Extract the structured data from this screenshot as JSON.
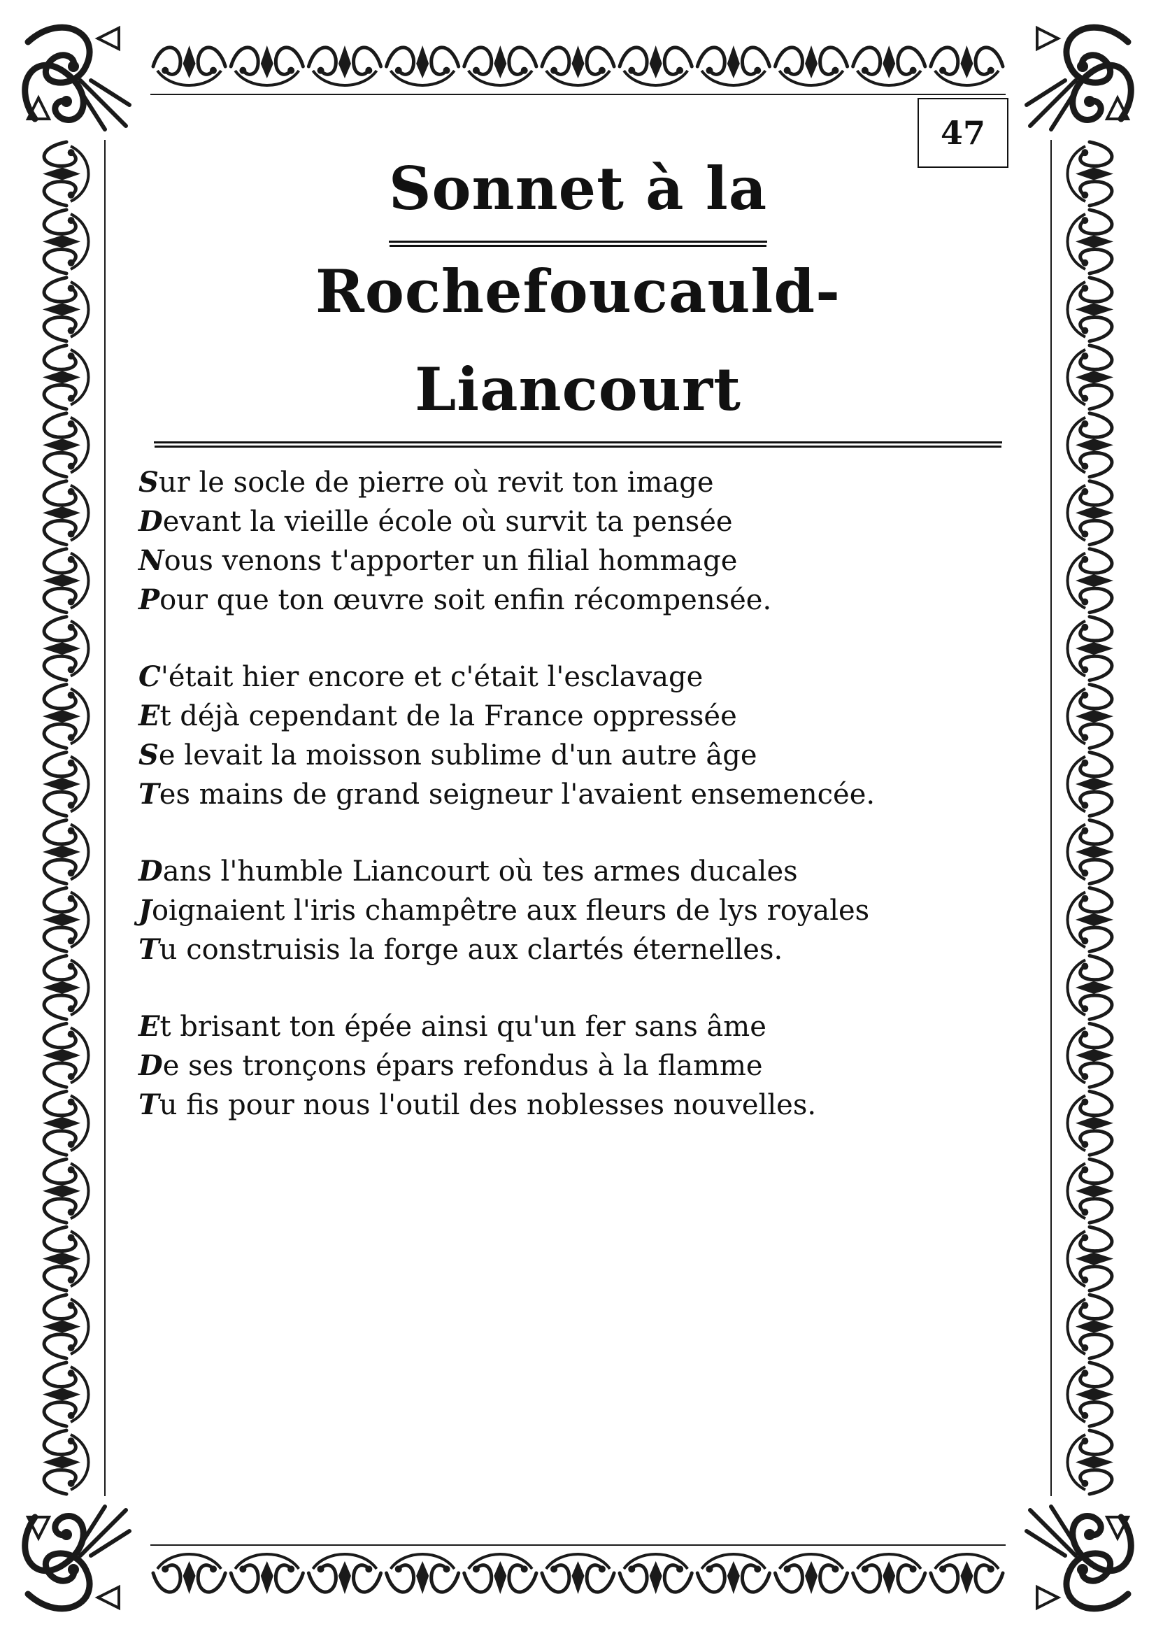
{
  "page": {
    "number": "47"
  },
  "title": {
    "line1": "Sonnet à la",
    "line2": "Rochefoucauld-Liancourt"
  },
  "poem": {
    "stanzas": [
      {
        "lines": [
          {
            "initial": "S",
            "rest": "ur le socle de pierre où revit ton image"
          },
          {
            "initial": "D",
            "rest": "evant la vieille école où survit ta pensée"
          },
          {
            "initial": "N",
            "rest": "ous venons t'apporter un filial hommage"
          },
          {
            "initial": "P",
            "rest": "our que ton œuvre soit enfin récompensée."
          }
        ]
      },
      {
        "lines": [
          {
            "initial": "C",
            "rest": "'était hier encore et c'était l'esclavage"
          },
          {
            "initial": "E",
            "rest": "t déjà cependant de la France oppressée"
          },
          {
            "initial": "S",
            "rest": "e levait la moisson sublime d'un autre âge"
          },
          {
            "initial": "T",
            "rest": "es mains de grand seigneur l'avaient ensemencée."
          }
        ]
      },
      {
        "lines": [
          {
            "initial": "D",
            "rest": "ans l'humble Liancourt où tes armes ducales"
          },
          {
            "initial": "J",
            "rest": "oignaient l'iris champêtre aux fleurs de lys royales"
          },
          {
            "initial": "T",
            "rest": "u construisis la forge aux clartés éternelles."
          }
        ]
      },
      {
        "lines": [
          {
            "initial": "E",
            "rest": "t brisant ton épée ainsi qu'un fer sans âme"
          },
          {
            "initial": "D",
            "rest": "e ses tronçons épars refondus à la flamme"
          },
          {
            "initial": "T",
            "rest": "u fis pour nous l'outil des noblesses nouvelles."
          }
        ]
      }
    ]
  },
  "ornament": {
    "color": "#1a1a1a"
  }
}
